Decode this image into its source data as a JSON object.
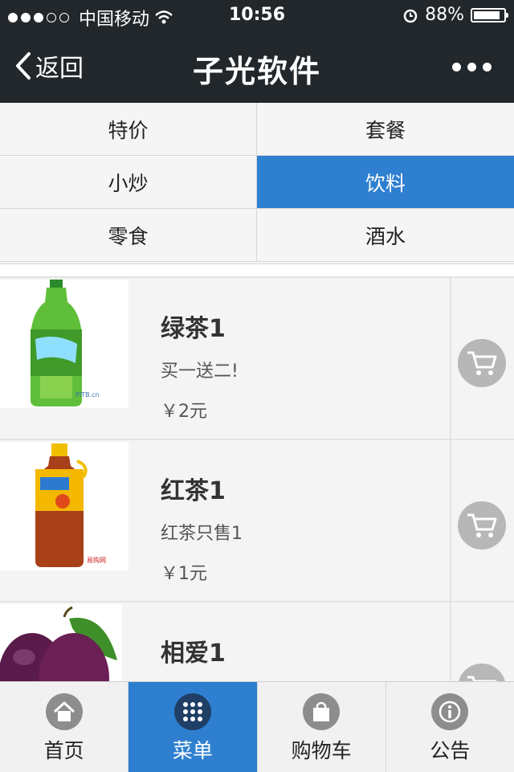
{
  "status_bar": {
    "carrier": "中国移动",
    "time": "10:56",
    "battery_text": "88%",
    "battery_level": 0.88
  },
  "nav": {
    "back_label": "返回",
    "title": "子光软件"
  },
  "categories": [
    {
      "label": "特价",
      "active": false
    },
    {
      "label": "套餐",
      "active": false
    },
    {
      "label": "小炒",
      "active": false
    },
    {
      "label": "饮料",
      "active": true
    },
    {
      "label": "零食",
      "active": false
    },
    {
      "label": "酒水",
      "active": false
    }
  ],
  "products": [
    {
      "name": "绿茶1",
      "desc": "买一送二!",
      "price": "￥2元",
      "image": "green-tea-bottle"
    },
    {
      "name": "红茶1",
      "desc": "红茶只售1",
      "price": "￥1元",
      "image": "black-tea-bottle"
    },
    {
      "name": "相爱1",
      "desc": "",
      "price": "",
      "image": "plum-fruit"
    }
  ],
  "tabs": [
    {
      "label": "首页",
      "icon": "home-icon",
      "active": false
    },
    {
      "label": "菜单",
      "icon": "grid-icon",
      "active": true
    },
    {
      "label": "购物车",
      "icon": "bag-icon",
      "active": false
    },
    {
      "label": "公告",
      "icon": "info-icon",
      "active": false
    }
  ],
  "colors": {
    "header_bg": "#22272b",
    "accent": "#2e7fd0",
    "cart_button": "#b7b7b7"
  }
}
